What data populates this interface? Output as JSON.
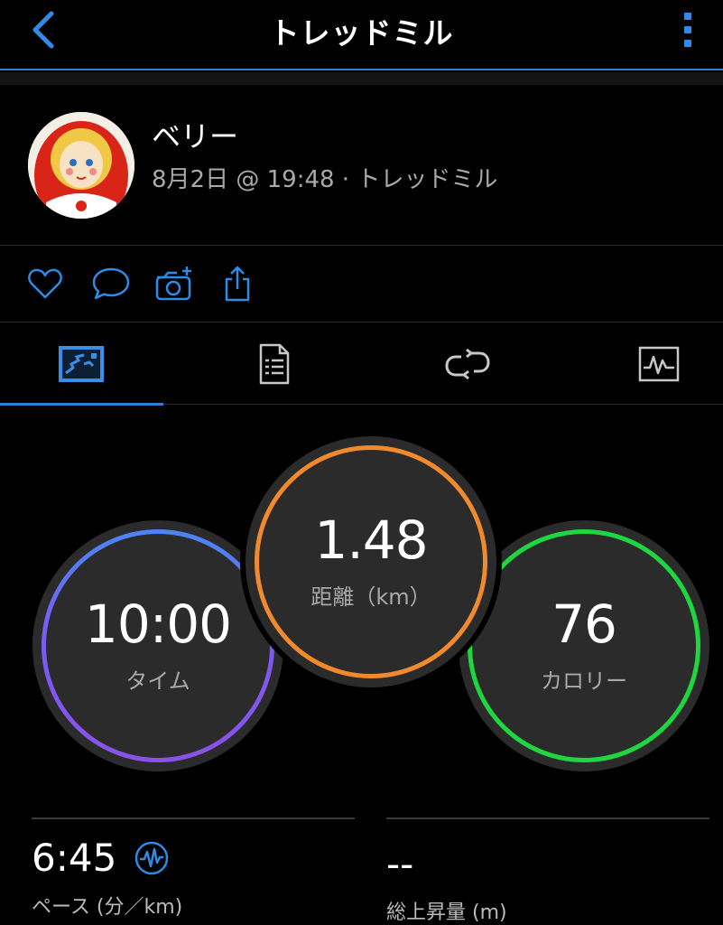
{
  "header": {
    "title": "トレッドミル"
  },
  "profile": {
    "name": "ベリー",
    "meta": "8月2日 @ 19:48 · トレッドミル"
  },
  "actions": [
    "heart-icon",
    "comment-icon",
    "add-photo-icon",
    "share-icon"
  ],
  "tabs": [
    {
      "icon": "map-overview-icon",
      "active": true
    },
    {
      "icon": "details-list-icon",
      "active": false
    },
    {
      "icon": "laps-icon",
      "active": false
    },
    {
      "icon": "chart-icon",
      "active": false
    }
  ],
  "summary": {
    "time": {
      "value": "10:00",
      "label": "タイム"
    },
    "distance": {
      "value": "1.48",
      "label": "距離（km）"
    },
    "calories": {
      "value": "76",
      "label": "カロリー"
    }
  },
  "stats": {
    "pace": {
      "value": "6:45",
      "label": "ペース (分／km)"
    },
    "elevation": {
      "value": "--",
      "label": "総上昇量 (m)"
    }
  },
  "colors": {
    "accent": "#2f7fd6",
    "time_ring": "#6a6af2",
    "distance_ring": "#f08a2c",
    "calories_ring": "#1ed640"
  }
}
